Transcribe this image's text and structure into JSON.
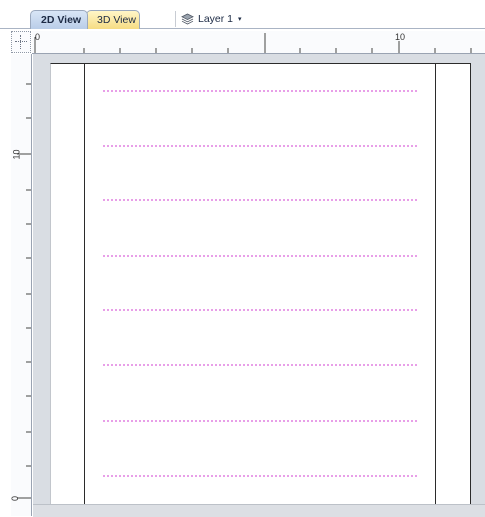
{
  "tabs": [
    {
      "label": "2D View",
      "active": true,
      "color": "#c6d6ee"
    },
    {
      "label": "3D View",
      "active": false,
      "color": "#f7e08f"
    }
  ],
  "layer": {
    "label": "Layer 1",
    "icon": "layer-stack-icon",
    "caret": "▾"
  },
  "rulers": {
    "horizontal": {
      "labels": [
        "0",
        "10"
      ]
    },
    "vertical": {
      "labels": [
        "10",
        "0"
      ]
    }
  },
  "canvas": {
    "background": "#d9dde3",
    "page_color": "#ffffff",
    "guide_color": "#d13fd1",
    "guide_count": 8
  }
}
